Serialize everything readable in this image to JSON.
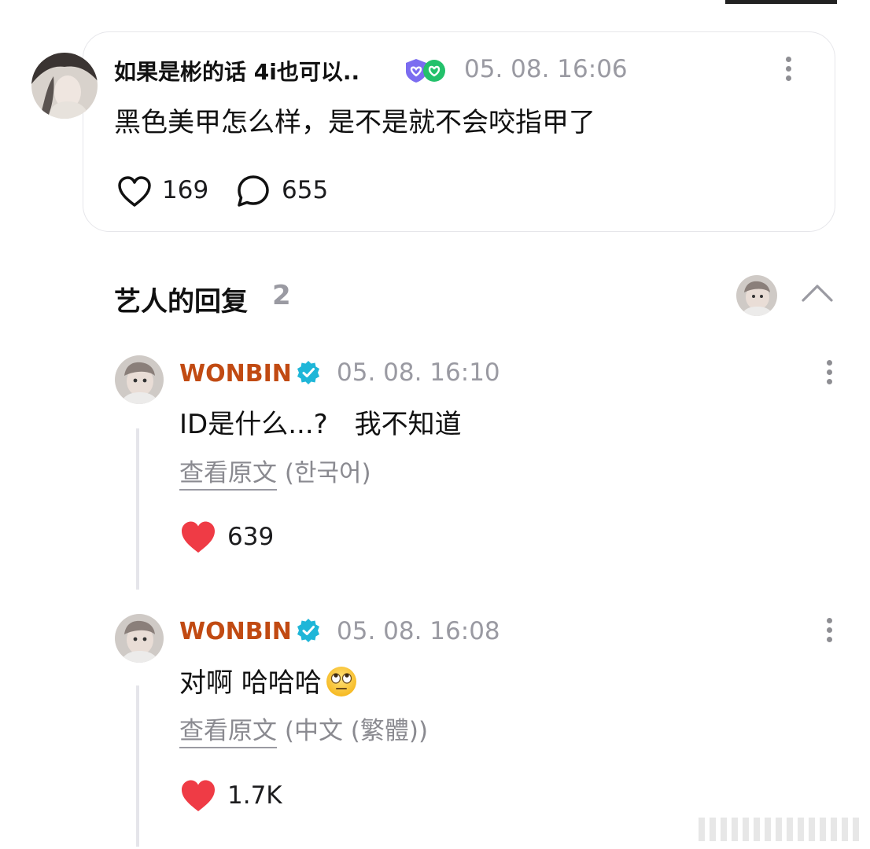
{
  "post": {
    "author": "如果是彬的话 4i也可以..",
    "time": "05. 08. 16:06",
    "text": "黑色美甲怎么样，是不是就不会咬指甲了",
    "likes": "169",
    "comments": "655"
  },
  "replies_section": {
    "title": "艺人的回复",
    "count": "2"
  },
  "replies": [
    {
      "name": "WONBIN",
      "time": "05. 08. 16:10",
      "text": "ID是什么...?　我不知道",
      "translate_link": "查看原文",
      "translate_lang": "(한국어)",
      "likes": "639"
    },
    {
      "name": "WONBIN",
      "time": "05. 08. 16:08",
      "text": "对啊 哈哈哈",
      "translate_link": "查看原文",
      "translate_lang": "(中文 (繁體))",
      "likes": "1.7K"
    }
  ],
  "colors": {
    "artist_name": "#c14a12",
    "verified": "#1fb6d8",
    "heart": "#ef3b45",
    "muted": "#9a9aa2"
  },
  "icons": [
    "heart-outline-icon",
    "comment-bubble-icon",
    "more-vertical-icon",
    "verified-badge-icon",
    "chevron-up-icon",
    "heart-filled-icon",
    "eye-roll-emoji"
  ]
}
